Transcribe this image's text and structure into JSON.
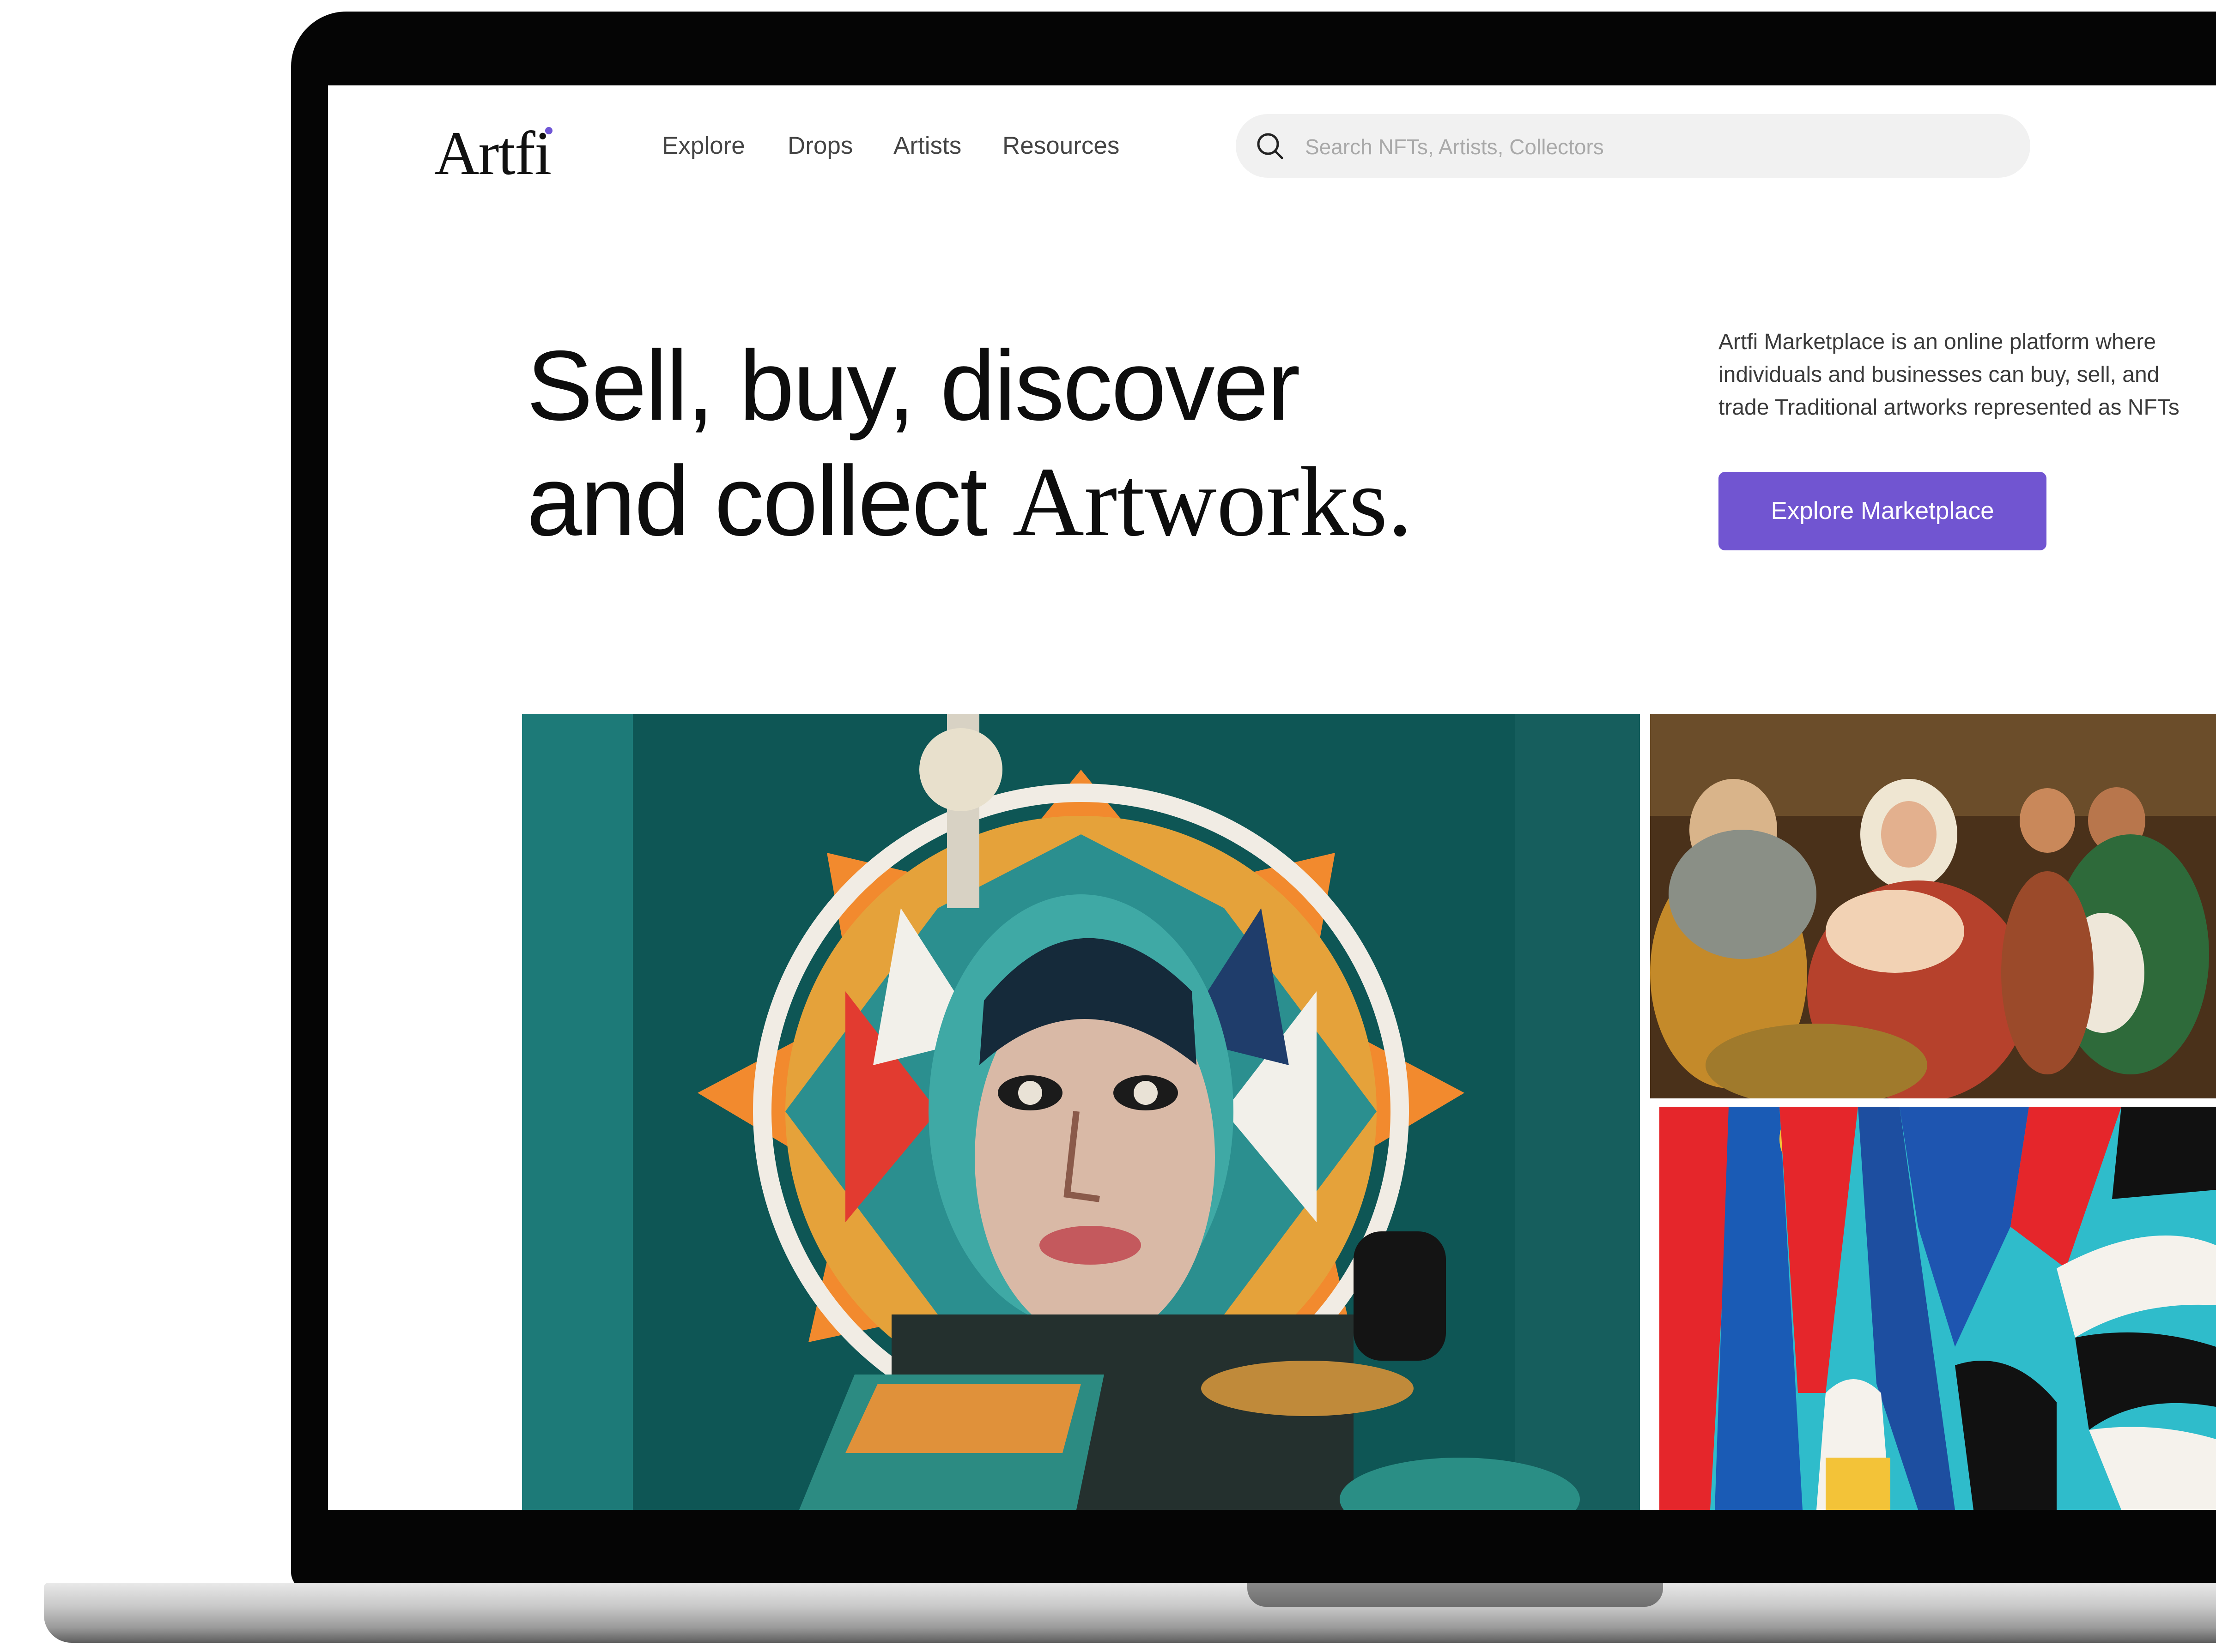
{
  "brand": {
    "logo_text": "Artfi",
    "accent_color": "#7155d1"
  },
  "nav": {
    "items": [
      {
        "label": "Explore"
      },
      {
        "label": "Drops"
      },
      {
        "label": "Artists"
      },
      {
        "label": "Resources"
      }
    ]
  },
  "search": {
    "placeholder": "Search NFTs, Artists, Collectors",
    "icon": "search-icon"
  },
  "hero": {
    "headline_line1": "Sell, buy, discover",
    "headline_line2_sans": "and collect ",
    "headline_line2_serif": "Artworks.",
    "description_lines": [
      "Artfi Marketplace is an online platform where",
      "individuals and businesses can buy, sell, and",
      "trade Traditional artworks represented as NFTs"
    ],
    "cta_label": "Explore Marketplace"
  },
  "gallery": {
    "images": [
      {
        "name": "street-mural-portrait"
      },
      {
        "name": "renaissance-nativity-painting"
      },
      {
        "name": "abstract-colorful-mural"
      }
    ]
  }
}
